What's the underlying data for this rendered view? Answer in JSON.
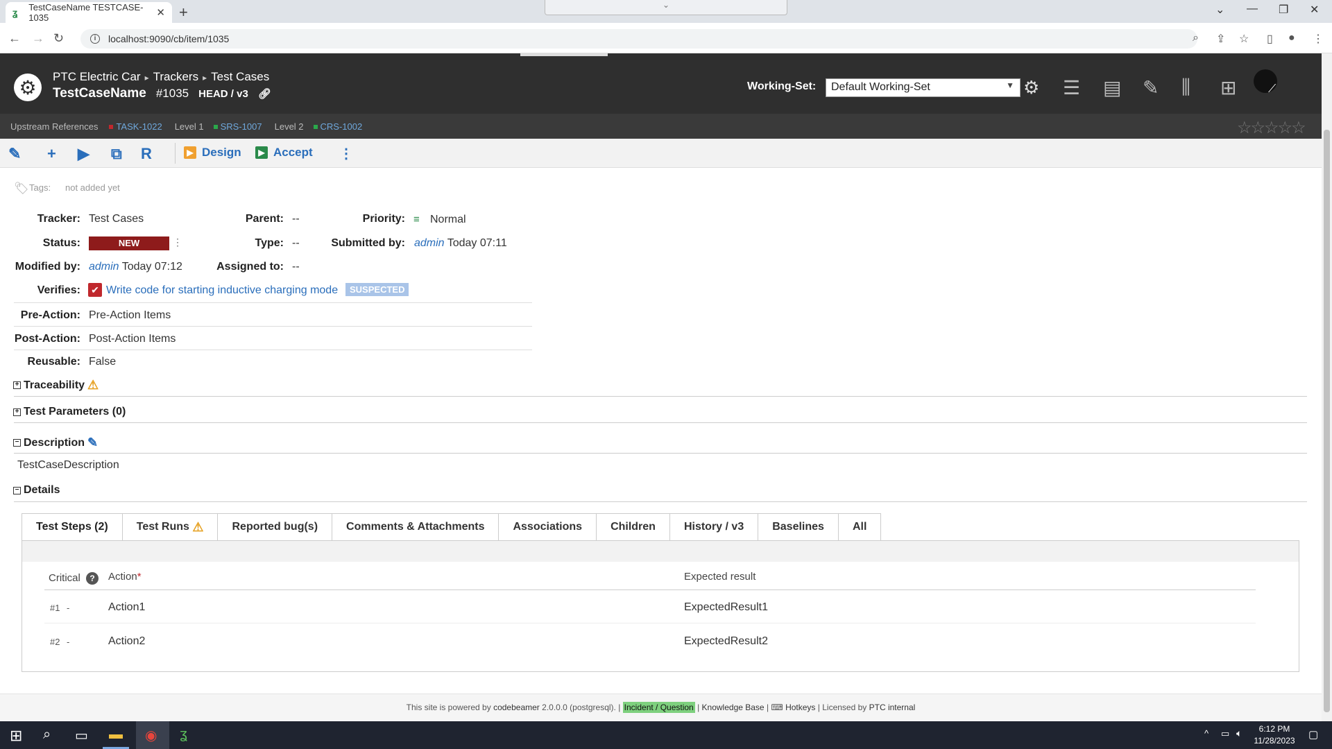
{
  "browser": {
    "tab_title": "TestCaseName TESTCASE-1035",
    "url": "localhost:9090/cb/item/1035"
  },
  "header": {
    "breadcrumb": [
      "PTC Electric Car",
      "Trackers",
      "Test Cases"
    ],
    "title": "TestCaseName",
    "item_id": "#1035",
    "version": "HEAD / v3",
    "working_set_label": "Working-Set:",
    "working_set_value": "Default Working-Set"
  },
  "upstream": {
    "label": "Upstream References",
    "refs": [
      {
        "text": "TASK-1022",
        "color": "#c0282d"
      },
      {
        "level": "Level 1"
      },
      {
        "text": "SRS-1007",
        "color": "#2aa84a"
      },
      {
        "level": "Level 2"
      },
      {
        "text": "CRS-1002",
        "color": "#2aa84a"
      }
    ]
  },
  "toolbar": {
    "design_label": "Design",
    "accept_label": "Accept"
  },
  "tags": {
    "label": "Tags:",
    "value": "not added yet"
  },
  "fields": {
    "tracker_label": "Tracker:",
    "tracker": "Test Cases",
    "parent_label": "Parent:",
    "parent": "--",
    "priority_label": "Priority:",
    "priority": "Normal",
    "status_label": "Status:",
    "status": "NEW",
    "type_label": "Type:",
    "type": "--",
    "submitted_label": "Submitted by:",
    "submitted_user": "admin",
    "submitted_time": "Today 07:11",
    "modified_label": "Modified by:",
    "modified_user": "admin",
    "modified_time": "Today 07:12",
    "assigned_label": "Assigned to:",
    "assigned": "--",
    "verifies_label": "Verifies:",
    "verifies": "Write code for starting inductive charging mode",
    "suspected": "SUSPECTED",
    "preaction_label": "Pre-Action:",
    "preaction": "Pre-Action Items",
    "postaction_label": "Post-Action:",
    "postaction": "Post-Action Items",
    "reusable_label": "Reusable:",
    "reusable": "False"
  },
  "sections": {
    "traceability": "Traceability",
    "test_parameters": "Test Parameters (0)",
    "description": "Description",
    "description_text": "TestCaseDescription",
    "details": "Details"
  },
  "detail_tabs": [
    "Test Steps (2)",
    "Test Runs",
    "Reported bug(s)",
    "Comments & Attachments",
    "Associations",
    "Children",
    "History / v3",
    "Baselines",
    "All"
  ],
  "steps_table": {
    "headers": {
      "critical": "Critical",
      "action": "Action",
      "required": "*",
      "expected": "Expected result"
    },
    "rows": [
      {
        "num": "#1",
        "dash": "-",
        "action": "Action1",
        "expected": "ExpectedResult1"
      },
      {
        "num": "#2",
        "dash": "-",
        "action": "Action2",
        "expected": "ExpectedResult2"
      }
    ]
  },
  "footer": {
    "prefix": "This site is powered by",
    "product": "codebeamer",
    "version": "2.0.0.0 (postgresql). |",
    "incident": "Incident / Question",
    "kb": "Knowledge Base",
    "hotkeys": "Hotkeys",
    "licensed": "| Licensed by",
    "licensee": "PTC internal"
  },
  "taskbar": {
    "time": "6:12 PM",
    "date": "11/28/2023"
  }
}
